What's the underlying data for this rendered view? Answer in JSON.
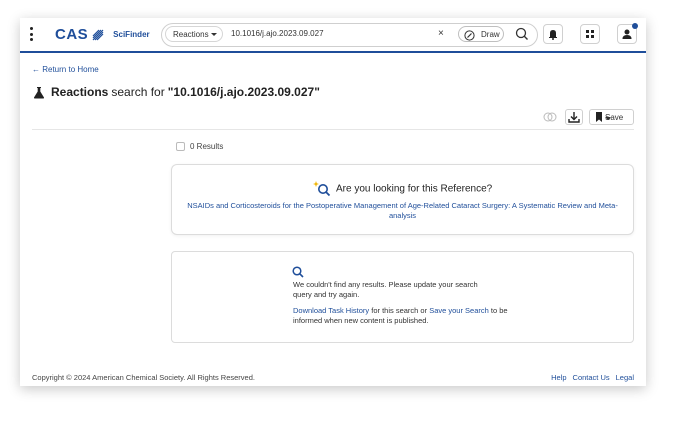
{
  "header": {
    "logo_text": "CAS",
    "product_name": "SciFinder",
    "search_type": "Reactions",
    "search_query": "10.1016/j.ajo.2023.09.027",
    "clear_symbol": "×",
    "draw_label": "Draw",
    "accent_color": "#1f4e9a"
  },
  "page": {
    "back_label": "Return to Home",
    "title_bold": "Reactions",
    "title_mid": "search for",
    "title_query": "\"10.1016/j.ajo.2023.09.027\"",
    "save_label": "Save",
    "results_count": "0 Results"
  },
  "reference_card": {
    "heading": "Are you looking for this Reference?",
    "link": "NSAIDs and Corticosteroids for the Postoperative Management of Age-Related Cataract Surgery: A Systematic Review and Meta-analysis"
  },
  "empty_state": {
    "message": "We couldn't find any results. Please update your search query and try again.",
    "download_link": "Download Task History",
    "middle_text": "for this search or",
    "save_link": "Save your Search",
    "end_text": "to be informed when new content is published."
  },
  "footer": {
    "copyright": "Copyright © 2024 American Chemical Society. All Rights Reserved.",
    "links": [
      "Help",
      "Contact Us",
      "Legal"
    ]
  }
}
